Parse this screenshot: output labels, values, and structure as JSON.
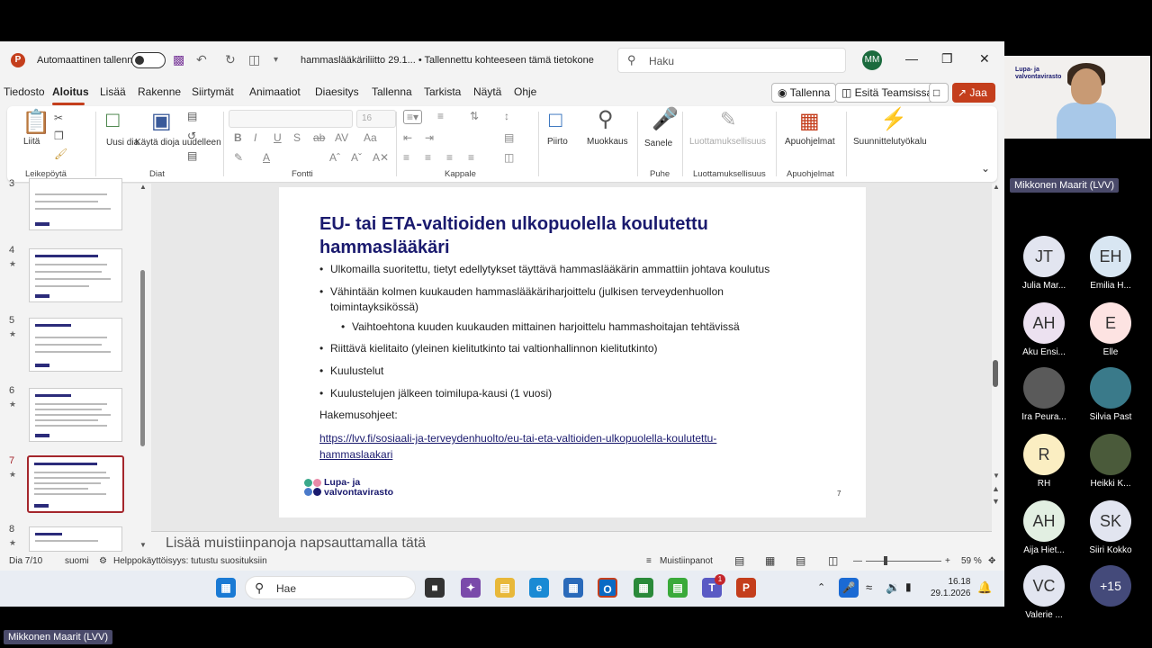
{
  "window": {
    "autosave_label": "Automaattinen tallennus",
    "doc_title": "hammaslääkäriliitto 29.1...  • Tallennettu kohteeseen tämä tietokone",
    "search_placeholder": "Haku",
    "user_initials": "MM"
  },
  "menu": {
    "tabs": [
      "Tiedosto",
      "Aloitus",
      "Lisää",
      "Rakenne",
      "Siirtymät",
      "Animaatiot",
      "Diaesitys",
      "Tallenna",
      "Tarkista",
      "Näytä",
      "Ohje"
    ],
    "record_btn": "Tallenna",
    "present_teams_btn": "Esitä Teamsissa",
    "share_btn": "Jaa"
  },
  "ribbon": {
    "paste": "Liitä",
    "clipboard": "Leikepöytä",
    "new_slide": "Uusi dia",
    "reuse_slides": "Käytä dioja uudelleen",
    "slides": "Diat",
    "font_size": "16",
    "font": "Fontti",
    "paragraph": "Kappale",
    "drawing": "Piirto",
    "editing": "Muokkaus",
    "dictate": "Sanele",
    "voice": "Puhe",
    "sensitivity": "Luottamuksellisuus",
    "addins": "Apuohjelmat",
    "designer": "Suunnittelutyökalu"
  },
  "thumbnails": [
    {
      "num": "3",
      "title": "EU-/ETA-maassa suoritettu koulutus / Automaattisen tunnustamisen piiri"
    },
    {
      "num": "4",
      "title": "EU-/ETA-maassa suoritettu koulutus"
    },
    {
      "num": "5",
      "title": "EU/ETA-ammattiin"
    },
    {
      "num": "6",
      "title": "EU/ETA-ammattiin"
    },
    {
      "num": "7",
      "title": "EU- tai ETA-valtioiden ulkopuolella koulutettu hammaslääkäri"
    },
    {
      "num": "8",
      "title": "Kuolettuja"
    }
  ],
  "slide": {
    "title": "EU- tai ETA-valtioiden ulkopuolella koulutettu hammaslääkäri",
    "bullets": [
      "Ulkomailla suoritettu, tietyt edellytykset täyttävä hammaslääkärin ammattiin johtava koulutus",
      "Vähintään kolmen kuukauden hammaslääkäriharjoittelu (julkisen terveydenhuollon",
      "toimintayksikössä)",
      "Vaihtoehtona kuuden kuukauden mittainen harjoittelu hammashoitajan tehtävissä",
      "Riittävä kielitaito (yleinen kielitutkinto tai valtionhallinnon kielitutkinto)",
      "Kuulustelut",
      "Kuulustelujen jälkeen toimilupa-kausi (1 vuosi)"
    ],
    "instructions_label": "Hakemusohjeet:",
    "link_line1": "https://lvv.fi/sosiaali-ja-terveydenhuolto/eu-tai-eta-valtioiden-ulkopuolella-koulutettu-",
    "link_line2": "hammaslaakari",
    "logo_line1": "Lupa- ja",
    "logo_line2": "valvontavirasto",
    "page_number": "7"
  },
  "notes_placeholder": "Lisää muistiinpanoja napsauttamalla tätä",
  "status": {
    "slide_of": "Dia 7/10",
    "language": "suomi",
    "accessibility": "Helppokäyttöisyys: tutustu suosituksiin",
    "notes_btn": "Muistiinpanot",
    "zoom": "59 %"
  },
  "taskbar": {
    "search_placeholder": "Hae",
    "time": "16.18",
    "date": "29.1.2026",
    "teams_badge": "1"
  },
  "teams": {
    "presenter_tag": "Mikkonen Maarit (LVV)",
    "video_logo_line1": "Lupa- ja",
    "video_logo_line2": "valvontavirasto",
    "bottom_tag": "Mikkonen Maarit (LVV)",
    "participants": [
      {
        "initials": "JT",
        "name": "Julia Mar...",
        "color": "#e2e5f0"
      },
      {
        "initials": "EH",
        "name": "Emilia H...",
        "color": "#d8e6f2"
      },
      {
        "initials": "AH",
        "name": "Aku Ensi...",
        "color": "#ece1f0"
      },
      {
        "initials": "E",
        "name": "Elle",
        "color": "#fde3e2"
      },
      {
        "initials": "",
        "name": "Ira Peura...",
        "color": "#5a5a5a"
      },
      {
        "initials": "",
        "name": "Silvia Past",
        "color": "#3a7a8a"
      },
      {
        "initials": "R",
        "name": "RH",
        "color": "#fbeec2"
      },
      {
        "initials": "",
        "name": "Heikki K...",
        "color": "#4a5a3a"
      },
      {
        "initials": "AH",
        "name": "Aija Hiet...",
        "color": "#e2efe2"
      },
      {
        "initials": "SK",
        "name": "Siiri Kokko",
        "color": "#e2e5f0"
      },
      {
        "initials": "VC",
        "name": "Valerie ...",
        "color": "#e2e5f0"
      },
      {
        "initials": "+15",
        "name": "",
        "color": "#444a7a"
      }
    ]
  }
}
